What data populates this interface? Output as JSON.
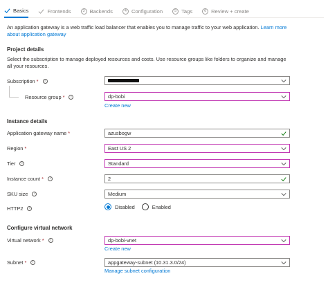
{
  "tabs": [
    {
      "label": "Basics",
      "state": "active",
      "icon": "check-icon"
    },
    {
      "label": "Frontends",
      "state": "done",
      "icon": "check-icon"
    },
    {
      "label": "Backends",
      "step": "3"
    },
    {
      "label": "Configuration",
      "step": "4"
    },
    {
      "label": "Tags",
      "step": "5"
    },
    {
      "label": "Review + create",
      "step": "6"
    }
  ],
  "intro": {
    "text": "An application gateway is a web traffic load balancer that enables you to manage traffic to your web application.",
    "link": "Learn more about application gateway"
  },
  "project": {
    "title": "Project details",
    "desc": "Select the subscription to manage deployed resources and costs. Use resource groups like folders to organize and manage all your resources.",
    "subscription_label": "Subscription",
    "resource_group_label": "Resource group",
    "resource_group_value": "dp-bobi",
    "create_new": "Create new"
  },
  "instance": {
    "title": "Instance details",
    "name_label": "Application gateway name",
    "name_value": "azusbogw",
    "region_label": "Region",
    "region_value": "East US 2",
    "tier_label": "Tier",
    "tier_value": "Standard",
    "count_label": "Instance count",
    "count_value": "2",
    "sku_label": "SKU size",
    "sku_value": "Medium",
    "http2_label": "HTTP2",
    "http2_options": [
      "Disabled",
      "Enabled"
    ],
    "http2_selected": "Disabled"
  },
  "vnet": {
    "title": "Configure virtual network",
    "vnet_label": "Virtual network",
    "vnet_value": "dp-bobi-vnet",
    "create_new": "Create new",
    "subnet_label": "Subnet",
    "subnet_value": "appgateway-subnet (10.31.3.0/24)",
    "manage_link": "Manage subnet configuration"
  },
  "colors": {
    "accent": "#0078d4",
    "required": "#a4262c",
    "highlight_border": "#c239b3",
    "valid": "#107c10"
  }
}
